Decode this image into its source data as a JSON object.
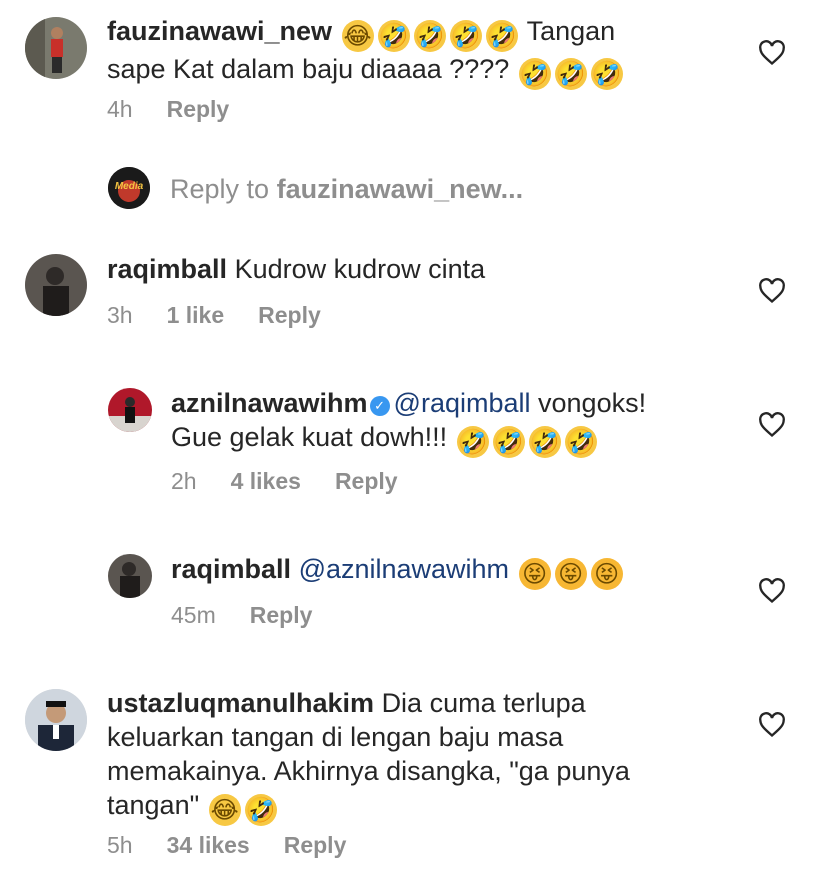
{
  "comments": [
    {
      "username": "fauzinawawi_new",
      "text_line1_after_emojis": "Tangan",
      "text_line2": "sape Kat dalam baju diaaaa ????",
      "time": "4h",
      "likes": "",
      "reply": "Reply"
    },
    {
      "username": "raqimball",
      "text": "Kudrow kudrow cinta",
      "time": "3h",
      "likes": "1 like",
      "reply": "Reply"
    },
    {
      "username": "aznilnawawihm",
      "mention": "@raqimball",
      "text_line1_rest": "vongoks!",
      "text_line2": "Gue gelak kuat dowh!!!",
      "time": "2h",
      "likes": "4 likes",
      "reply": "Reply"
    },
    {
      "username": "raqimball",
      "mention": "@aznilnawawihm",
      "time": "45m",
      "likes": "",
      "reply": "Reply"
    },
    {
      "username": "ustazluqmanulhakim",
      "text_line1": "Dia cuma terlupa",
      "text_line2": "keluarkan tangan di lengan baju masa",
      "text_line3": "memakainya. Akhirnya disangka, \"ga punya",
      "text_line4": "tangan\"",
      "time": "5h",
      "likes": "34 likes",
      "reply": "Reply"
    }
  ],
  "reply_composer": {
    "prefix": "Reply to",
    "target": "fauzinawawi_new...",
    "avatar_logo_text": "Media"
  },
  "icons": {
    "heart": "heart-outline-icon",
    "verified": "verified-badge-icon",
    "laugh_emoji": "tears-of-joy-emoji",
    "rofl_emoji": "rolling-laughing-emoji",
    "tongue_emoji": "squinting-tongue-emoji"
  },
  "colors": {
    "text": "#262626",
    "meta": "#8e8e8e",
    "mention": "#1b3d76",
    "verified": "#3897f0"
  }
}
